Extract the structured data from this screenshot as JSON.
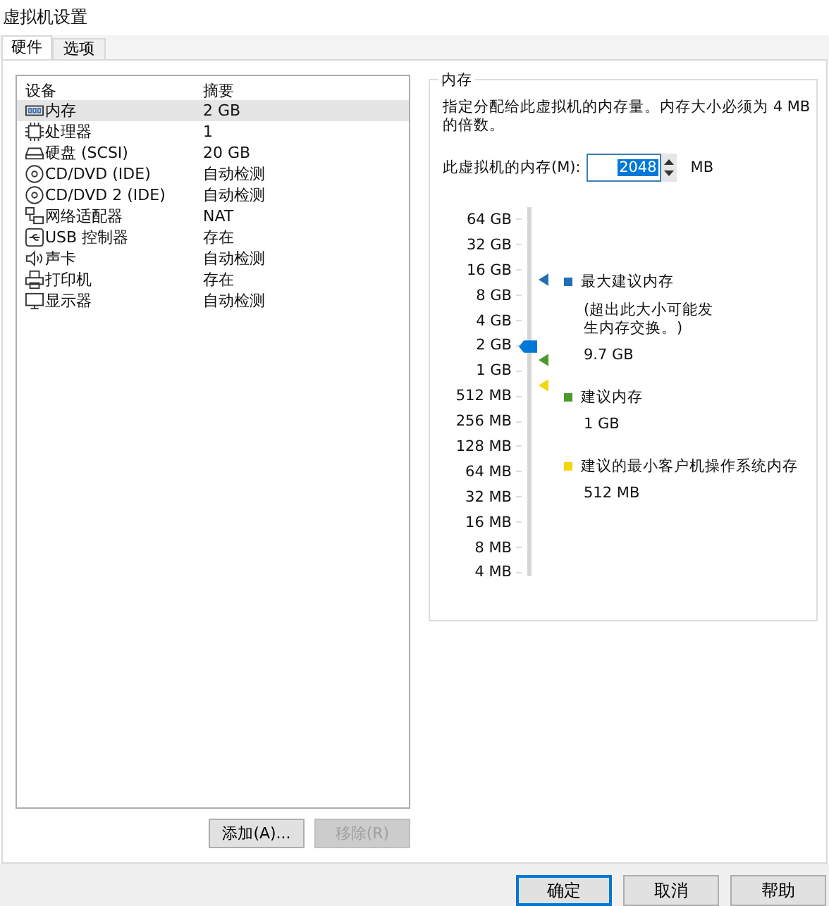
{
  "window": {
    "title": "虚拟机设置"
  },
  "tabs": [
    {
      "label": "硬件",
      "selected": true
    },
    {
      "label": "选项",
      "selected": false
    }
  ],
  "devices": {
    "columns": [
      "设备",
      "摘要"
    ],
    "rows": [
      {
        "kind": "memory",
        "name": "内存",
        "summary": "2 GB",
        "selected": true
      },
      {
        "kind": "cpu",
        "name": "处理器",
        "summary": "1",
        "selected": false
      },
      {
        "kind": "disk",
        "name": "硬盘 (SCSI)",
        "summary": "20 GB",
        "selected": false
      },
      {
        "kind": "cd",
        "name": "CD/DVD (IDE)",
        "summary": "自动检测",
        "selected": false
      },
      {
        "kind": "cd",
        "name": "CD/DVD 2 (IDE)",
        "summary": "自动检测",
        "selected": false
      },
      {
        "kind": "network",
        "name": "网络适配器",
        "summary": "NAT",
        "selected": false
      },
      {
        "kind": "usb",
        "name": "USB 控制器",
        "summary": "存在",
        "selected": false
      },
      {
        "kind": "sound",
        "name": "声卡",
        "summary": "自动检测",
        "selected": false
      },
      {
        "kind": "printer",
        "name": "打印机",
        "summary": "存在",
        "selected": false
      },
      {
        "kind": "display",
        "name": "显示器",
        "summary": "自动检测",
        "selected": false
      }
    ],
    "buttons": [
      {
        "label": "添加(A)...",
        "disabled": false
      },
      {
        "label": "移除(R)",
        "disabled": true
      }
    ]
  },
  "memory": {
    "title": "内存",
    "description": "指定分配给此虚拟机的内存量。内存大小必须为 4 MB 的倍数。",
    "field_label": "此虚拟机的内存(M):",
    "value": "2048",
    "unit": "MB",
    "scale": [
      "64 GB",
      "32 GB",
      "16 GB",
      "8 GB",
      "4 GB",
      "2 GB",
      "1 GB",
      "512 MB",
      "256 MB",
      "128 MB",
      "64 MB",
      "32 MB",
      "16 MB",
      "8 MB",
      "4 MB"
    ],
    "slider": {
      "level": 0.643
    },
    "markers": [
      {
        "title": "最大建议内存",
        "note": "(超出此大小可能发生内存交换。)",
        "value": "9.7 GB",
        "color": "#1f6fb5"
      },
      {
        "title": "建议内存",
        "value": "1 GB",
        "color": "#4b9a2a"
      },
      {
        "title": "建议的最小客户机操作系统内存",
        "value": "512 MB",
        "color": "#f2d70f"
      }
    ]
  },
  "footer": [
    {
      "label": "确定",
      "default": true
    },
    {
      "label": "取消",
      "default": false
    },
    {
      "label": "帮助",
      "default": false
    }
  ]
}
